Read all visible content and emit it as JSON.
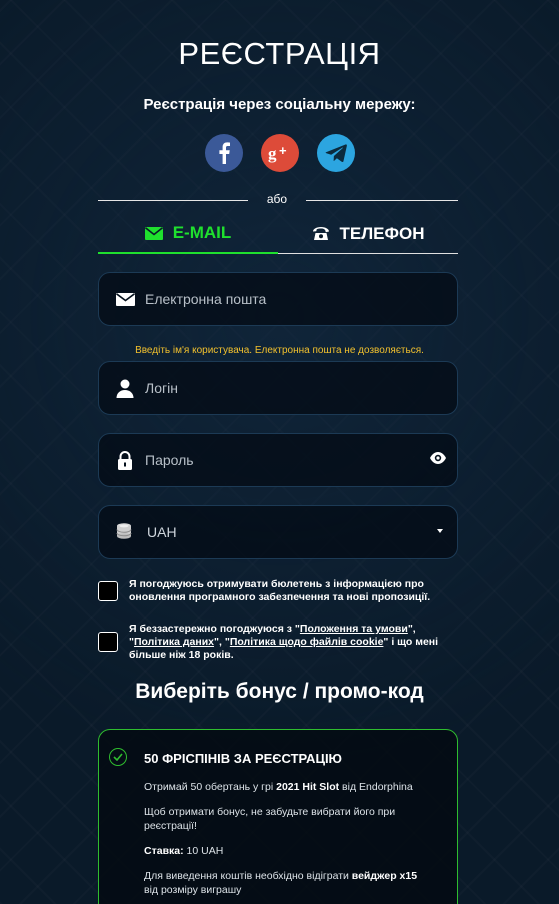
{
  "page": {
    "title": "РЕЄСТРАЦІЯ",
    "social_caption": "Реєстрація через соціальну мережу:",
    "or_label": "або"
  },
  "social": [
    {
      "name": "facebook",
      "icon": "facebook-icon",
      "color": "#3b5998"
    },
    {
      "name": "google-plus",
      "icon": "google-plus-icon",
      "color": "#dd4b39"
    },
    {
      "name": "telegram",
      "icon": "telegram-icon",
      "color": "#2ca5e0"
    }
  ],
  "tabs": [
    {
      "label": "E-MAIL",
      "icon": "envelope-icon",
      "active": true
    },
    {
      "label": "ТЕЛЕФОН",
      "icon": "phone-icon",
      "active": false
    }
  ],
  "form": {
    "email_placeholder": "Електронна пошта",
    "username_hint": "Введіть ім'я користувача. Електронна пошта не дозволяється.",
    "login_placeholder": "Логін",
    "password_placeholder": "Пароль",
    "currency_value": "UAH"
  },
  "consents": {
    "newsletter": "Я погоджуюсь отримувати бюлетень з інформацією про оновлення програмного забезпечення та нові пропозиції.",
    "terms_prefix": "Я беззастережно погоджуюся з \"",
    "terms_link": "Положення та умови",
    "terms_sep1": "\",\n\"",
    "privacy_link": "Політика даних",
    "terms_sep2": "\", \"",
    "cookie_link": "Політика щодо файлів cookie",
    "terms_suffix": "\" і що мені більше ніж 18 років."
  },
  "bonus": {
    "heading": "Виберіть бонус / промо-код",
    "title": "50 ФРІСПІНІВ ЗА РЕЄСТРАЦІЮ",
    "line1_prefix": "Отримай 50 обертань у грі ",
    "line1_game": "2021 Hit Slot",
    "line1_suffix": " від Endorphina",
    "line2": "Щоб отримати бонус, не забудьте вибрати його при реєстрації!",
    "stake_label": "Ставка:",
    "stake_value": " 10 UAH",
    "wager_prefix": "Для виведення коштів необхідно відіграти ",
    "wager_value": "вейджер x15",
    "wager_suffix": " від розміру виграшу"
  },
  "colors": {
    "accent_green": "#1fe02e",
    "warning_yellow": "#f2c12e",
    "background": "#0a1a29"
  }
}
